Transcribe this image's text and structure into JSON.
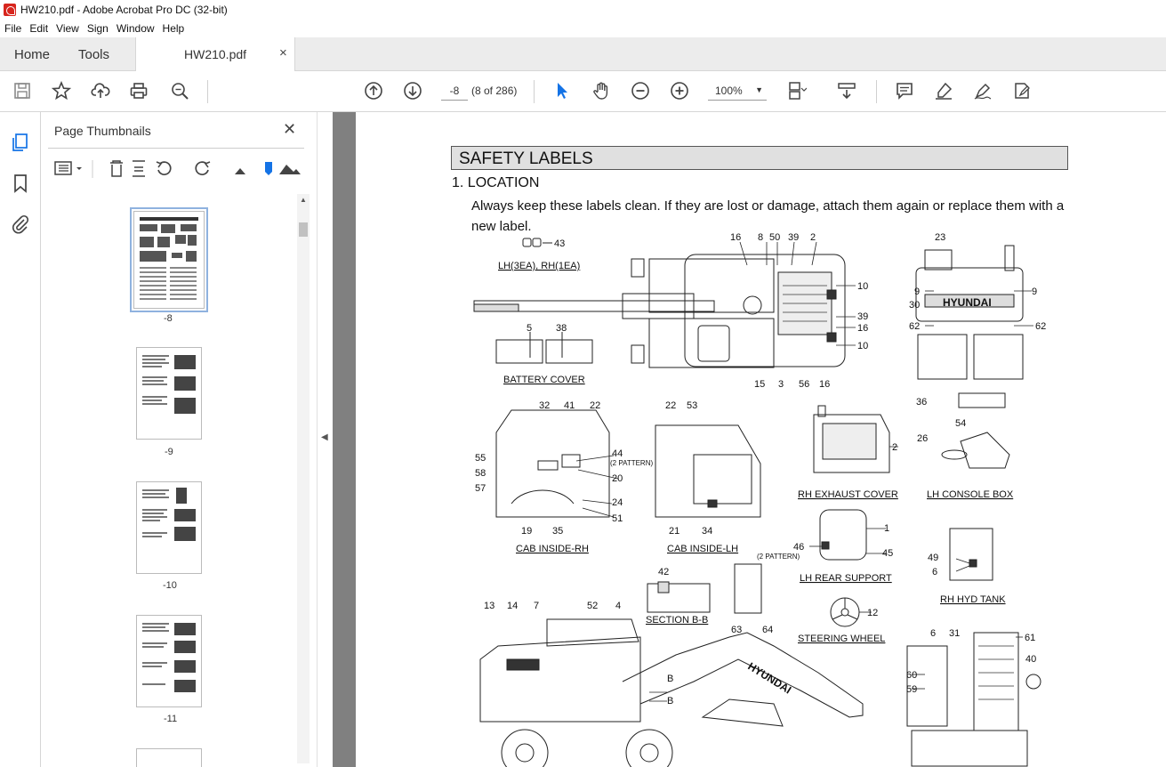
{
  "window": {
    "title": "HW210.pdf - Adobe Acrobat Pro DC (32-bit)"
  },
  "menu": [
    "File",
    "Edit",
    "View",
    "Sign",
    "Window",
    "Help"
  ],
  "tabs": {
    "home": "Home",
    "tools": "Tools",
    "document": "HW210.pdf",
    "close": "×"
  },
  "toolbar": {
    "page_value": "-8",
    "page_of": "(8 of 286)",
    "zoom": "100%"
  },
  "icons": [
    "save-icon",
    "star-icon",
    "upload-icon",
    "print-icon",
    "zoom-search-icon",
    "page-up-icon",
    "page-down-icon",
    "select-arrow-icon",
    "hand-icon",
    "zoom-out-icon",
    "zoom-in-icon",
    "page-view-icon",
    "scroll-icon",
    "comment-icon",
    "highlight-icon",
    "sign-icon",
    "fill-sign-icon"
  ],
  "panel": {
    "title": "Page Thumbnails",
    "close": "✕",
    "thumbnails": [
      {
        "label": "-8",
        "selected": true
      },
      {
        "label": "-9",
        "selected": false
      },
      {
        "label": "-10",
        "selected": false
      },
      {
        "label": "-11",
        "selected": false
      }
    ]
  },
  "document": {
    "heading": "SAFETY LABELS",
    "section": "1.  LOCATION",
    "paragraph": "Always keep these labels clean.  If they are lost or damage, attach them again or replace them with a new label.",
    "captions": {
      "lh_rh": "LH(3EA), RH(1EA)",
      "battery": "BATTERY COVER",
      "cab_rh": "CAB INSIDE-RH",
      "cab_lh": "CAB INSIDE-LH",
      "rh_exhaust": "RH EXHAUST COVER",
      "lh_console": "LH CONSOLE BOX",
      "lh_rear": "LH REAR SUPPORT",
      "rh_hyd": "RH HYD TANK",
      "section_bb": "SECTION B-B",
      "steering": "STEERING WHEEL",
      "pattern1": "(2 PATTERN)",
      "pattern2": "(2 PATTERN)",
      "brand1": "HYUNDAI",
      "brand2": "HYUNDAI",
      "b1": "B",
      "b2": "B"
    },
    "callouts": [
      "43",
      "5",
      "38",
      "16",
      "8",
      "50",
      "39",
      "2",
      "10",
      "39",
      "16",
      "10",
      "15",
      "3",
      "56",
      "16",
      "23",
      "9",
      "9",
      "30",
      "62",
      "62",
      "32",
      "41",
      "22",
      "55",
      "44",
      "58",
      "20",
      "57",
      "24",
      "51",
      "19",
      "35",
      "22",
      "53",
      "21",
      "34",
      "2",
      "36",
      "54",
      "26",
      "1",
      "46",
      "45",
      "49",
      "6",
      "42",
      "12",
      "13",
      "14",
      "7",
      "52",
      "4",
      "63",
      "64",
      "6",
      "31",
      "61",
      "60",
      "40",
      "59"
    ]
  }
}
